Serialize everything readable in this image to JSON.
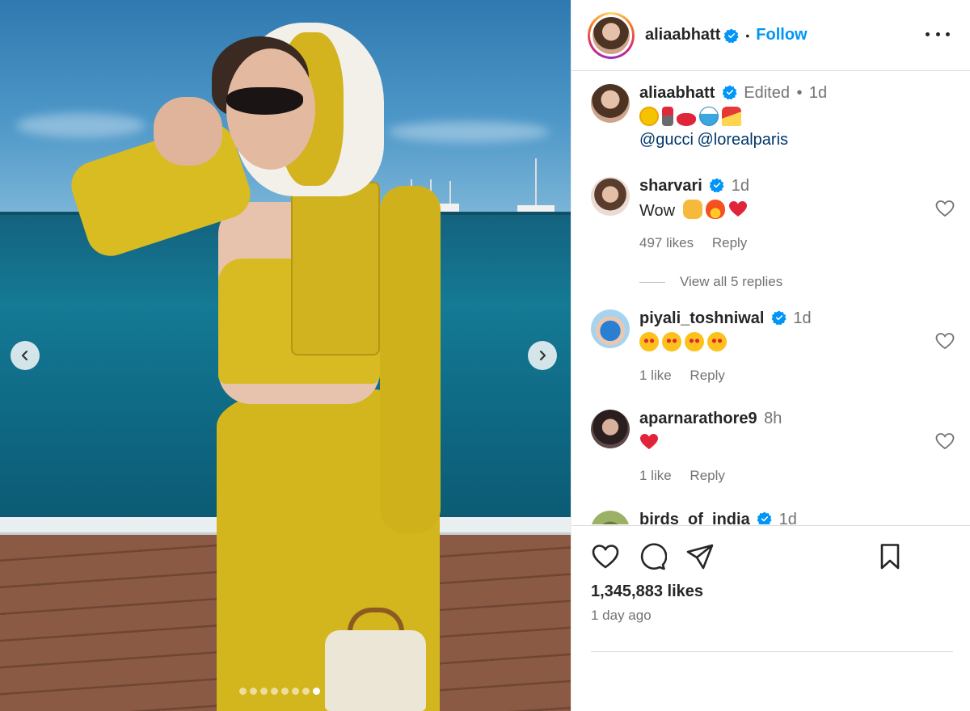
{
  "post": {
    "author": "aliaabhatt",
    "follow_label": "Follow",
    "caption_meta": "Edited",
    "caption_age": "1d",
    "caption_emojis": [
      "sun-emoji",
      "lipstick-emoji",
      "lips-emoji",
      "wave-emoji",
      "beach-umbrella-emoji"
    ],
    "mentions": [
      "@gucci",
      "@lorealparis"
    ],
    "likes": "1,345,883 likes",
    "posted": "1 day ago",
    "carousel": {
      "slide_count": 8,
      "active_slide": 8
    }
  },
  "comments": [
    {
      "user": "sharvari",
      "verified": true,
      "age": "1d",
      "text": "Wow",
      "emojis": [
        "raised-hands-emoji",
        "fire-emoji",
        "red-heart-emoji"
      ],
      "likes": "497 likes",
      "reply": "Reply",
      "view_replies": "View all 5 replies"
    },
    {
      "user": "piyali_toshniwal",
      "verified": true,
      "age": "1d",
      "text": "",
      "emojis": [
        "heart-eyes-emoji",
        "heart-eyes-emoji",
        "heart-eyes-emoji",
        "heart-eyes-emoji"
      ],
      "likes": "1 like",
      "reply": "Reply"
    },
    {
      "user": "aparnarathore9",
      "verified": false,
      "age": "8h",
      "text": "",
      "emojis": [
        "red-heart-emoji"
      ],
      "likes": "1 like",
      "reply": "Reply"
    },
    {
      "user": "birds_of_india",
      "verified": true,
      "age": "1d"
    }
  ],
  "colors": {
    "link_blue": "#0095f6",
    "mention_blue": "#00376b",
    "verified_blue": "#0095f6",
    "muted": "#737373",
    "dress_yellow": "#d3b51e"
  },
  "icons": [
    "more-options-icon",
    "like-icon",
    "comment-icon",
    "share-icon",
    "save-icon",
    "chevron-left-icon",
    "chevron-right-icon",
    "verified-badge-icon"
  ]
}
